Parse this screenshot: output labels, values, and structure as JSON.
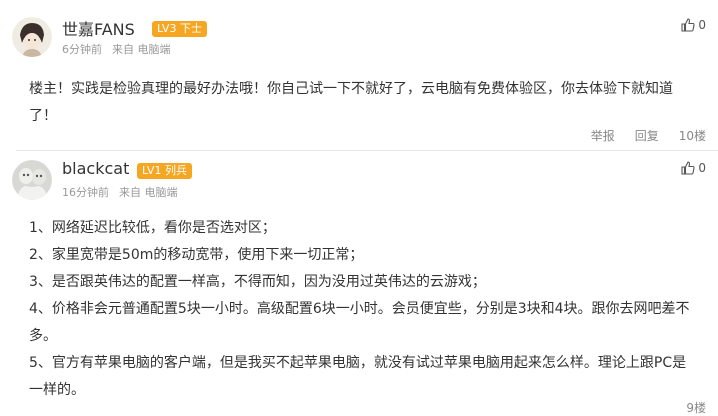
{
  "comments": [
    {
      "username": "世嘉FANS",
      "badge": "LV3 下士",
      "time": "6分钟前",
      "source": "来自 电脑端",
      "likes": "0",
      "lines": [
        "楼主！实践是检验真理的最好办法哦！你自己试一下不就好了，云电脑有免费体验区，你去体验下就知道",
        "了！"
      ],
      "report_label": "举报",
      "reply_label": "回复",
      "floor": "10楼",
      "badge_color": "#f5a623"
    },
    {
      "username": "blackcat",
      "badge": "LV1 列兵",
      "time": "16分钟前",
      "source": "来自 电脑端",
      "likes": "0",
      "lines": [
        "1、网络延迟比较低，看你是否选对区；",
        "2、家里宽带是50m的移动宽带，使用下来一切正常；",
        "3、是否跟英伟达的配置一样高，不得而知，因为没用过英伟达的云游戏；",
        "4、价格非会元普通配置5块一小时。高级配置6块一小时。会员便宜些，分别是3块和4块。跟你去网吧差不",
        "多。",
        "5、官方有苹果电脑的客户端，但是我买不起苹果电脑，就没有试过苹果电脑用起来怎么样。理论上跟PC是",
        "一样的。"
      ],
      "floor": "9楼",
      "badge_color": "#f5a623"
    }
  ],
  "icons": {
    "like": "thumbs-up-icon"
  }
}
